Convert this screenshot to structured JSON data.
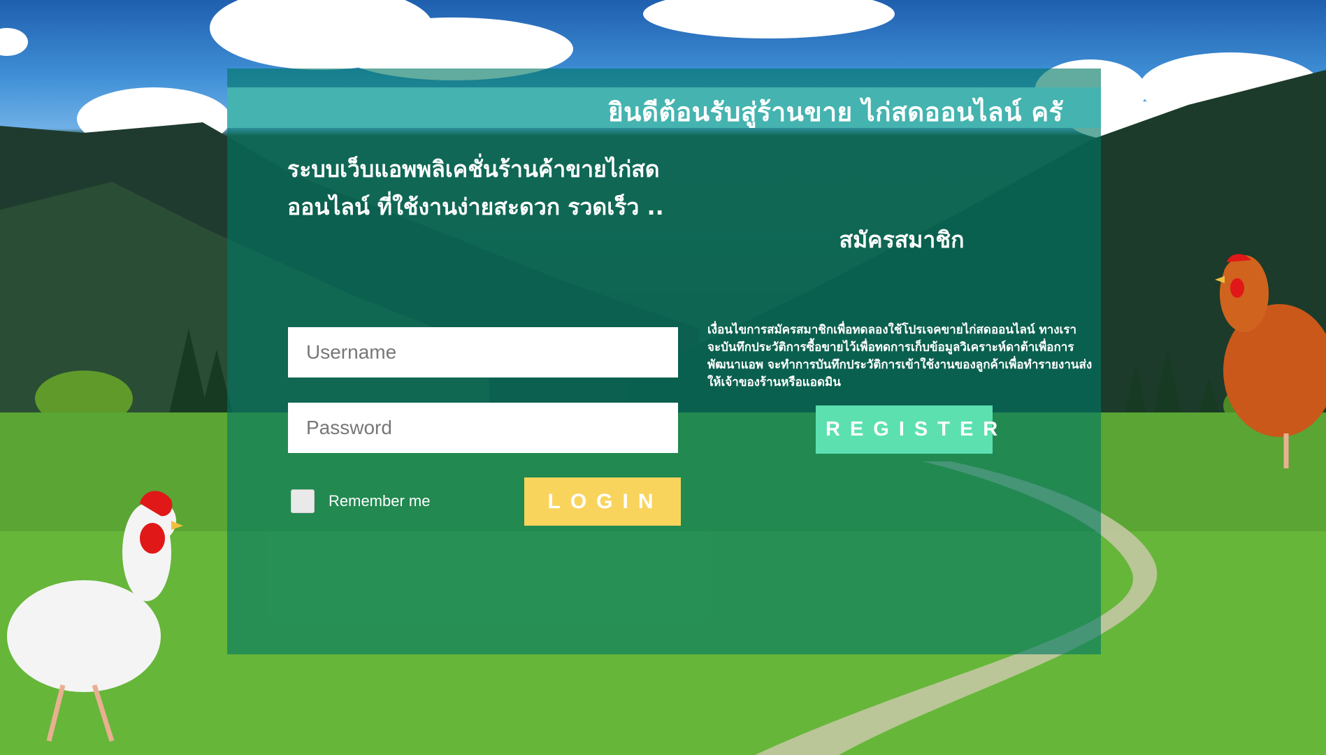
{
  "banner": {
    "welcome_text": "ยินดีต้อนรับสู่ร้านขาย ไก่สดออนไลน์ ครั"
  },
  "login": {
    "tagline": "ระบบเว็บแอพพลิเคชั่นร้านค้าขายไก่สดออนไลน์ ที่ใช้งานง่ายสะดวก รวดเร็ว ..",
    "username_placeholder": "Username",
    "password_placeholder": "Password",
    "remember_label": "Remember me",
    "login_label": "LOGIN"
  },
  "signup": {
    "title": "สมัครสมาชิก",
    "terms": "เงื่อนไขการสมัครสมาชิกเพื่อทดลองใช้โปรเจคขายไก่สดออนไลน์ ทางเราจะบันทึกประวัติการซื้อขายไว้เพื่อทดการเก็บข้อมูลวิเคราะห์ดาต้าเพื่อการพัฒนาแอพ จะทำการบันทึกประวัติการเข้าใช้งานของลูกค้าเพื่อทำรายงานส่งให้เจ้าของร้านหรือแอดมิน",
    "register_label": "REGISTER"
  },
  "colors": {
    "panel": "#00786480",
    "banner": "#45b3b0",
    "login_button": "#f9d45d",
    "register_button": "#5ce0b0"
  },
  "icons": {
    "decor_left": "white-chicken-icon",
    "decor_right": "brown-hen-icon"
  }
}
